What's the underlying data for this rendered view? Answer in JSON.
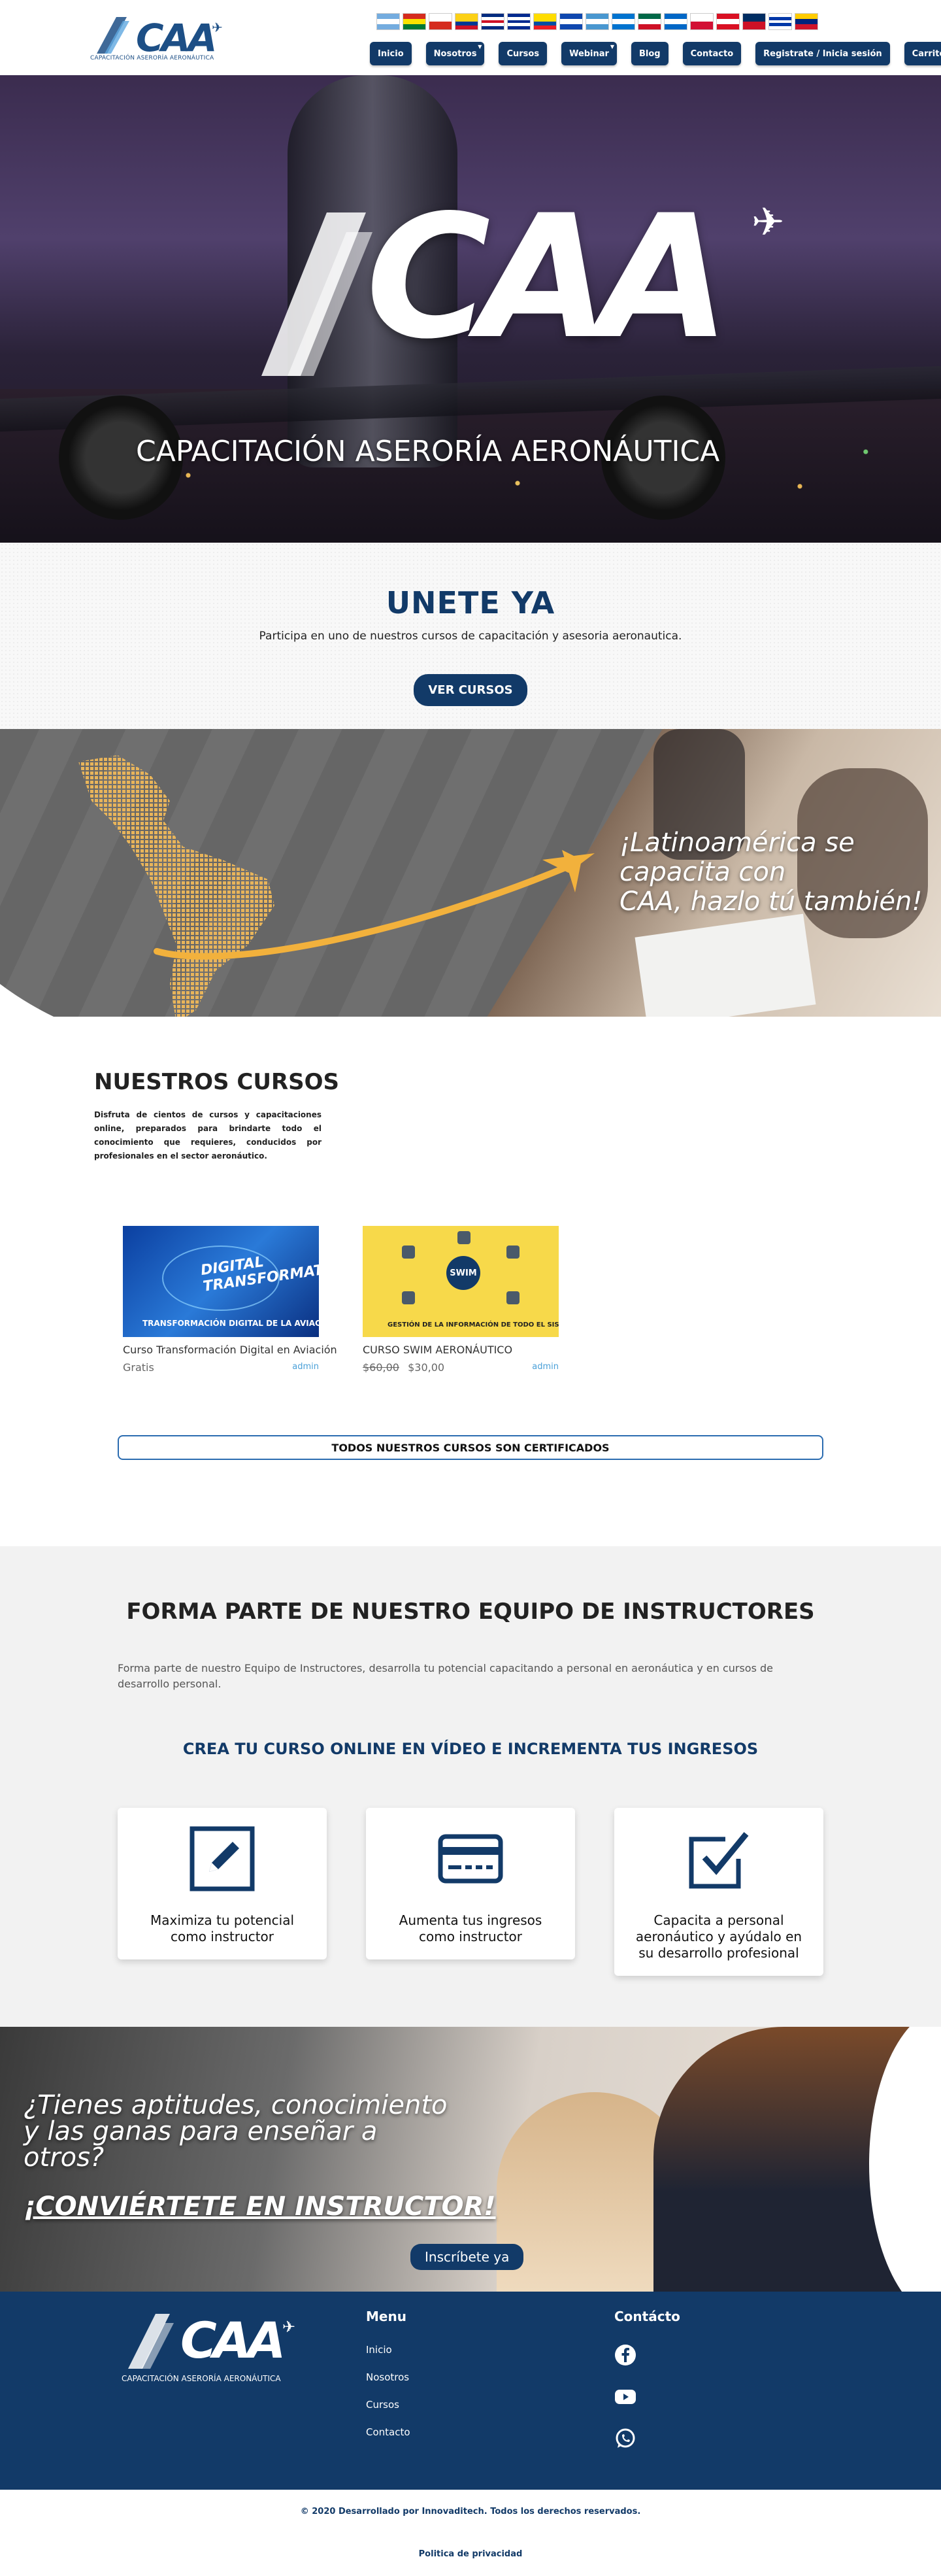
{
  "header": {
    "logo_text": "CAA",
    "logo_tagline": "CAPACITACIÓN ASERORÍA AERONÁUTICA",
    "flags": [
      {
        "name": "argentina",
        "colors": [
          "#74acdf",
          "#ffffff",
          "#74acdf"
        ]
      },
      {
        "name": "bolivia",
        "colors": [
          "#d52b1e",
          "#f9e300",
          "#007934"
        ]
      },
      {
        "name": "chile",
        "colors": [
          "#ffffff",
          "#d52b1e"
        ]
      },
      {
        "name": "colombia",
        "colors": [
          "#fcd116",
          "#fcd116",
          "#003893",
          "#ce1126"
        ]
      },
      {
        "name": "costa-rica",
        "colors": [
          "#002b7f",
          "#ffffff",
          "#ce1126",
          "#ffffff",
          "#002b7f"
        ]
      },
      {
        "name": "cuba",
        "colors": [
          "#002a8f",
          "#ffffff",
          "#002a8f",
          "#ffffff",
          "#002a8f"
        ]
      },
      {
        "name": "ecuador",
        "colors": [
          "#ffdd00",
          "#ffdd00",
          "#034ea2",
          "#ed1c24"
        ]
      },
      {
        "name": "el-salvador",
        "colors": [
          "#0f47af",
          "#ffffff",
          "#0f47af"
        ]
      },
      {
        "name": "guatemala",
        "colors": [
          "#4997d0",
          "#ffffff",
          "#4997d0"
        ]
      },
      {
        "name": "honduras",
        "colors": [
          "#0073cf",
          "#ffffff",
          "#0073cf"
        ]
      },
      {
        "name": "mexico",
        "colors": [
          "#006847",
          "#ffffff",
          "#ce1126"
        ]
      },
      {
        "name": "nicaragua",
        "colors": [
          "#0067c6",
          "#ffffff",
          "#0067c6"
        ]
      },
      {
        "name": "panama",
        "colors": [
          "#ffffff",
          "#d21034"
        ]
      },
      {
        "name": "peru",
        "colors": [
          "#d91023",
          "#ffffff",
          "#d91023"
        ]
      },
      {
        "name": "dominican-republic",
        "colors": [
          "#002d62",
          "#ce1126"
        ]
      },
      {
        "name": "uruguay",
        "colors": [
          "#ffffff",
          "#0038a8",
          "#ffffff",
          "#0038a8",
          "#ffffff"
        ]
      },
      {
        "name": "venezuela",
        "colors": [
          "#ffcc00",
          "#00247d",
          "#cf142b"
        ]
      }
    ],
    "nav": [
      {
        "label": "Inicio",
        "dropdown": false
      },
      {
        "label": "Nosotros",
        "dropdown": true
      },
      {
        "label": "Cursos",
        "dropdown": false
      },
      {
        "label": "Webinar",
        "dropdown": true
      },
      {
        "label": "Blog",
        "dropdown": false
      },
      {
        "label": "Contacto",
        "dropdown": false
      },
      {
        "label": "Registrate / Inicia sesión",
        "dropdown": false
      },
      {
        "label": "Carrito",
        "dropdown": false
      }
    ]
  },
  "hero": {
    "logo_text": "CAA",
    "tagline": "CAPACITACIÓN ASERORÍA AERONÁUTICA"
  },
  "unete": {
    "title": "UNETE YA",
    "subtitle": "Participa en uno de nuestros cursos de capacitación y asesoria aeronautica.",
    "button": "VER CURSOS"
  },
  "latam": {
    "slogan_line1": "¡Latinoamérica se",
    "slogan_line2": "capacita con",
    "slogan_line3": "CAA, hazlo tú también!"
  },
  "cursos": {
    "title": "NUESTROS CURSOS",
    "description": "Disfruta de cientos de cursos y capacitaciones online, preparados para brindarte todo el conocimiento que requieres, conducidos por profesionales en el sector aeronáutico.",
    "items": [
      {
        "title": "Curso Transformación Digital en Aviación",
        "price": "Gratis",
        "old_price": "",
        "author": "admin",
        "thumb_line1": "DIGITAL TRANSFORMATION",
        "thumb_line2": "TRANSFORMACIÓN DIGITAL DE LA AVIACIÓN"
      },
      {
        "title": "CURSO SWIM AERONÁUTICO",
        "price": "$30,00",
        "old_price": "$60,00",
        "author": "admin",
        "thumb_line1": "SWIM",
        "thumb_line2": "GESTIÓN DE LA INFORMACIÓN DE TODO EL SISTEMA"
      }
    ],
    "certificados": "TODOS NUESTROS CURSOS SON CERTIFICADOS"
  },
  "instructores": {
    "title": "FORMA PARTE DE NUESTRO EQUIPO DE INSTRUCTORES",
    "description": "Forma parte de nuestro Equipo de Instructores, desarrolla tu potencial capacitando a personal en aeronáutica y en cursos de desarrollo personal.",
    "subtitle": "CREA TU CURSO ONLINE EN VÍDEO E INCREMENTA TUS INGRESOS",
    "features": [
      {
        "icon": "pencil-icon",
        "label_line1": "Maximiza tu potencial",
        "label_line2": "como instructor",
        "label_line3": ""
      },
      {
        "icon": "credit-card-icon",
        "label_line1": "Aumenta tus ingresos",
        "label_line2": "como instructor",
        "label_line3": ""
      },
      {
        "icon": "checkbox-icon",
        "label_line1": "Capacita a personal",
        "label_line2": "aeronáutico y ayúdalo en",
        "label_line3": "su desarrollo profesional"
      }
    ]
  },
  "cta": {
    "question_line1": "¿Tienes aptitudes, conocimiento",
    "question_line2": "y las ganas para enseñar a",
    "question_line3": "otros?",
    "headline": "¡CONVIÉRTETE EN INSTRUCTOR!",
    "button": "Inscríbete ya"
  },
  "footer": {
    "logo_text": "CAA",
    "logo_tagline": "CAPACITACIÓN ASERORÍA AERONÁUTICA",
    "menu_title": "Menu",
    "menu": [
      "Inicio",
      "Nosotros",
      "Cursos",
      "Contacto"
    ],
    "contact_title": "Contácto",
    "social": [
      "facebook-icon",
      "youtube-icon",
      "whatsapp-icon"
    ],
    "copyright": "© 2020 Desarrollado por Innovaditech. Todos los derechos reservados.",
    "privacy": "Politica de privacidad"
  },
  "colors": {
    "brand_navy": "#123a68",
    "brand_blue": "#1d4f86",
    "accent_gold": "#f2b13c",
    "link_blue": "#4aa0d8"
  }
}
